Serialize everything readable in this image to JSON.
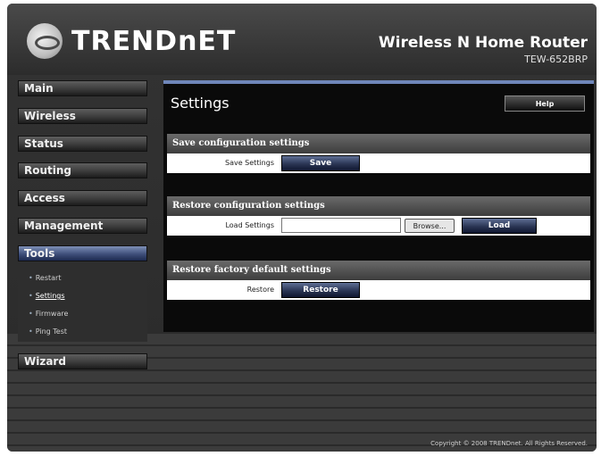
{
  "brand": {
    "logo_text": "TRENDnET",
    "product_name": "Wireless N Home Router",
    "model": "TEW-652BRP"
  },
  "colors": {
    "accent": "#6f86b9",
    "active_nav": "#3f4f7a",
    "background": "#3a3a3a"
  },
  "sidebar": {
    "items": [
      {
        "label": "Main"
      },
      {
        "label": "Wireless"
      },
      {
        "label": "Status"
      },
      {
        "label": "Routing"
      },
      {
        "label": "Access"
      },
      {
        "label": "Management"
      },
      {
        "label": "Tools"
      },
      {
        "label": "Wizard"
      }
    ],
    "tools_subitems": [
      {
        "label": "Restart"
      },
      {
        "label": "Settings"
      },
      {
        "label": "Firmware"
      },
      {
        "label": "Ping Test"
      }
    ]
  },
  "main": {
    "title": "Settings",
    "help_label": "Help",
    "sections": [
      {
        "header": "Save configuration settings",
        "row_label": "Save Settings",
        "button_label": "Save"
      },
      {
        "header": "Restore configuration settings",
        "row_label": "Load Settings",
        "file_value": "",
        "browse_label": "Browse...",
        "button_label": "Load"
      },
      {
        "header": "Restore factory default settings",
        "row_label": "Restore",
        "button_label": "Restore"
      }
    ]
  },
  "footer": {
    "copyright": "Copyright © 2008 TRENDnet. All Rights Reserved."
  }
}
